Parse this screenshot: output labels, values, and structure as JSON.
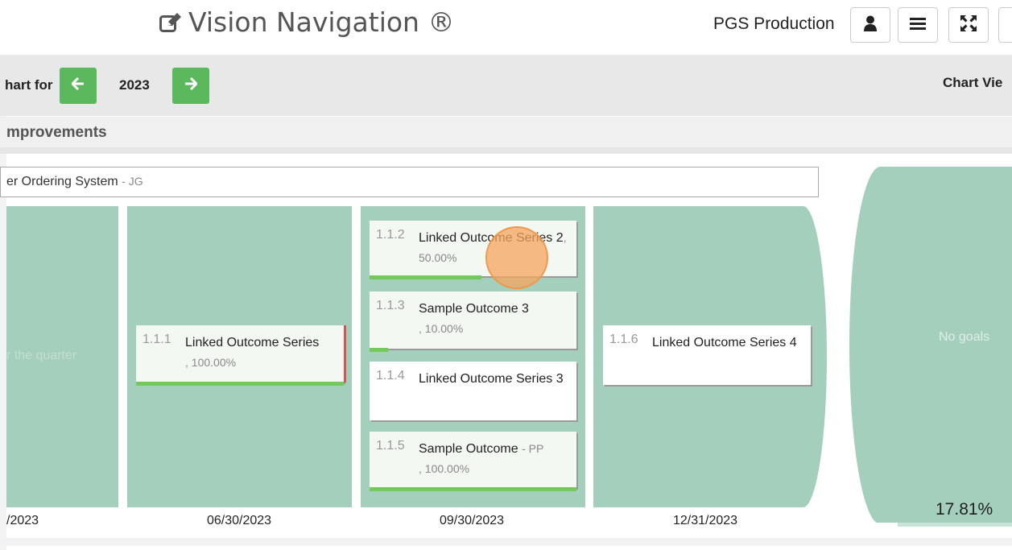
{
  "header": {
    "app_title": "Vision Navigation ®",
    "org_name": "PGS Production",
    "buttons": [
      {
        "name": "user-icon"
      },
      {
        "name": "menu-icon"
      },
      {
        "name": "fullscreen-icon"
      }
    ]
  },
  "toolbar": {
    "chart_for_label": "hart for",
    "year": "2023",
    "chart_view_label": "Chart Vie",
    "accent_color": "#5cb85c"
  },
  "section": {
    "title": "mprovements"
  },
  "goal": {
    "title": "er Ordering System",
    "owner": "- JG"
  },
  "columns": [
    {
      "date": "/2023",
      "placeholder": "r the quarter",
      "cards": []
    },
    {
      "date": "06/30/2023",
      "cards": [
        {
          "num": "1.1.1",
          "title": "Linked Outcome Series",
          "meta": ", 100.00%",
          "progress": 1.0,
          "flag": "red"
        }
      ]
    },
    {
      "date": "09/30/2023",
      "cards": [
        {
          "num": "1.1.2",
          "title": "Linked Outcome Series 2",
          "meta": ", 50.00%",
          "progress": 0.5
        },
        {
          "num": "1.1.3",
          "title": "Sample Outcome 3",
          "meta": ", 10.00%",
          "progress": 0.1
        },
        {
          "num": "1.1.4",
          "title": "Linked Outcome Series 3",
          "meta": "",
          "progress": 0
        },
        {
          "num": "1.1.5",
          "title": "Sample Outcome",
          "owner": "- PP",
          "meta": ", 100.00%",
          "progress": 1.0
        }
      ]
    },
    {
      "date": "12/31/2023",
      "cards": [
        {
          "num": "1.1.6",
          "title": "Linked Outcome Series 4",
          "meta": "",
          "progress": 0
        }
      ]
    }
  ],
  "summary": {
    "placeholder": "No goals",
    "total_percent": "17.81%",
    "footer_progress": 0.25
  },
  "colors": {
    "column_bg": "#a4cfbd",
    "progress": "#74c95c",
    "flag_red": "#d9534f"
  }
}
